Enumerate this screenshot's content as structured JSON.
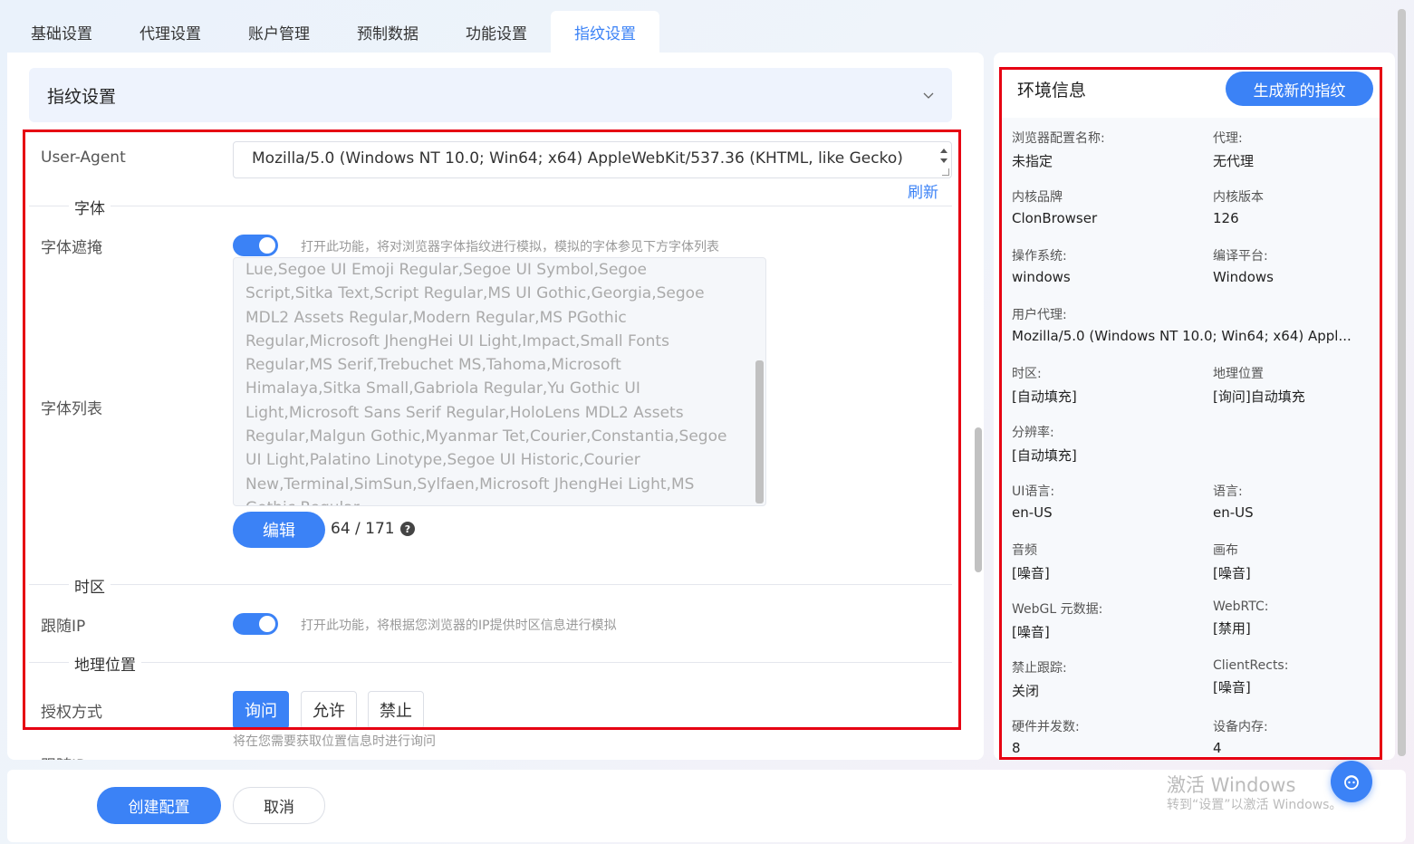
{
  "tabs": [
    "基础设置",
    "代理设置",
    "账户管理",
    "预制数据",
    "功能设置",
    "指纹设置"
  ],
  "active_tab": 5,
  "section_title": "指纹设置",
  "user_agent": {
    "label": "User-Agent",
    "value": "Mozilla/5.0 (Windows NT 10.0; Win64; x64) AppleWebKit/537.36 (KHTML, like Gecko)",
    "refresh_label": "刷新"
  },
  "font": {
    "divider": "字体",
    "mask_label": "字体遮掩",
    "mask_hint": "打开此功能，将对浏览器字体指纹进行模拟，模拟的字体参见下方字体列表",
    "list_label": "字体列表",
    "list_text": "Lue,Segoe UI Emoji Regular,Segoe UI Symbol,Segoe Script,Sitka Text,Script Regular,MS UI Gothic,Georgia,Segoe MDL2 Assets Regular,Modern Regular,MS PGothic Regular,Microsoft JhengHei UI Light,Impact,Small Fonts Regular,MS Serif,Trebuchet MS,Tahoma,Microsoft Himalaya,Sitka Small,Gabriola Regular,Yu Gothic UI Light,Microsoft Sans Serif Regular,HoloLens MDL2 Assets Regular,Malgun Gothic,Myanmar Tet,Courier,Constantia,Segoe UI Light,Palatino Linotype,Segoe UI Historic,Courier New,Terminal,SimSun,Sylfaen,Microsoft JhengHei Light,MS Gothic Regular",
    "edit_label": "编辑",
    "count": "64 / 171",
    "help": "?"
  },
  "timezone": {
    "divider": "时区",
    "follow_label": "跟随IP",
    "follow_hint": "打开此功能，将根据您浏览器的IP提供时区信息进行模拟"
  },
  "geo": {
    "divider": "地理位置",
    "auth_label": "授权方式",
    "options": [
      "询问",
      "允许",
      "禁止"
    ],
    "hint": "将在您需要获取位置信息时进行询问",
    "next_label": "跟随IP"
  },
  "env": {
    "title": "环境信息",
    "generate_label": "生成新的指纹",
    "items": [
      {
        "key": "浏览器配置名称:",
        "value": "未指定"
      },
      {
        "key": "代理:",
        "value": "无代理"
      },
      {
        "key": "内核品牌",
        "value": "ClonBrowser"
      },
      {
        "key": "内核版本",
        "value": "126"
      },
      {
        "key": "操作系统:",
        "value": "windows"
      },
      {
        "key": "编译平台:",
        "value": "Windows"
      },
      {
        "key": "用户代理:",
        "value": "Mozilla/5.0 (Windows NT 10.0; Win64; x64) Appl..."
      },
      {
        "key": "时区:",
        "value": "[自动填充]"
      },
      {
        "key": "地理位置",
        "value": "[询问]自动填充"
      },
      {
        "key": "分辨率:",
        "value": "[自动填充]"
      },
      {
        "key": "UI语言:",
        "value": "en-US"
      },
      {
        "key": "语言:",
        "value": "en-US"
      },
      {
        "key": "音频",
        "value": "[噪音]"
      },
      {
        "key": "画布",
        "value": "[噪音]"
      },
      {
        "key": "WebGL 元数据:",
        "value": "[噪音]"
      },
      {
        "key": "WebRTC:",
        "value": "[禁用]"
      },
      {
        "key": "禁止跟踪:",
        "value": "关闭"
      },
      {
        "key": "ClientRects:",
        "value": "[噪音]"
      },
      {
        "key": "硬件并发数:",
        "value": "8"
      },
      {
        "key": "设备内存:",
        "value": "4"
      }
    ]
  },
  "footer": {
    "create_label": "创建配置",
    "cancel_label": "取消"
  },
  "watermark": {
    "line1": "激活 Windows",
    "line2": "转到“设置”以激活 Windows。"
  },
  "colors": {
    "accent": "#3b82f6",
    "highlight": "#e60012"
  }
}
